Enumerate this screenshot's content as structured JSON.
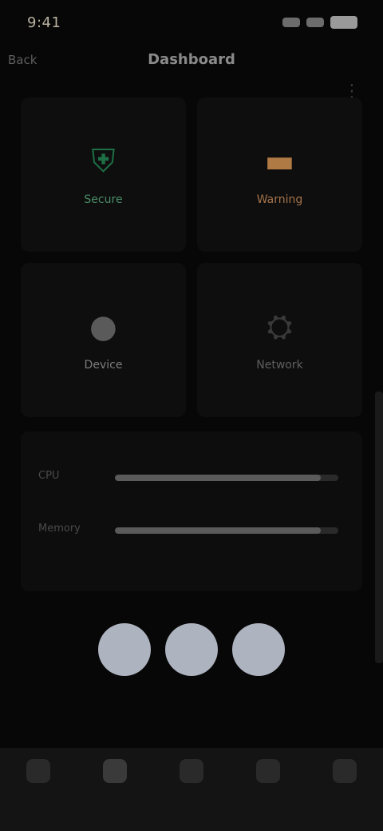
{
  "status": {
    "time": "9:41"
  },
  "appbar": {
    "left": "Back",
    "title": "Dashboard",
    "right_icon": "more-icon"
  },
  "cards": [
    {
      "label": "Secure",
      "sub": "",
      "icon": "shield-icon",
      "accent": "#1d6f45"
    },
    {
      "label": "Warning",
      "sub": "",
      "icon": "alert-icon",
      "accent": "#b07a44"
    },
    {
      "label": "Device",
      "sub": "",
      "icon": "device-icon",
      "accent": "#5a5a5a"
    },
    {
      "label": "Network",
      "sub": "",
      "icon": "network-icon",
      "accent": "#3a3a3a"
    }
  ],
  "panel": {
    "rows": [
      {
        "label": "CPU",
        "progress": 0.92
      },
      {
        "label": "Memory",
        "progress": 0.92
      }
    ],
    "footer_left": "",
    "footer_right": ""
  },
  "actions": {
    "buttons": [
      "",
      "",
      ""
    ],
    "caption": ""
  },
  "bottom_nav": {
    "items": [
      {
        "label": ""
      },
      {
        "label": ""
      },
      {
        "label": ""
      },
      {
        "label": ""
      },
      {
        "label": ""
      }
    ],
    "active_index": 1
  }
}
